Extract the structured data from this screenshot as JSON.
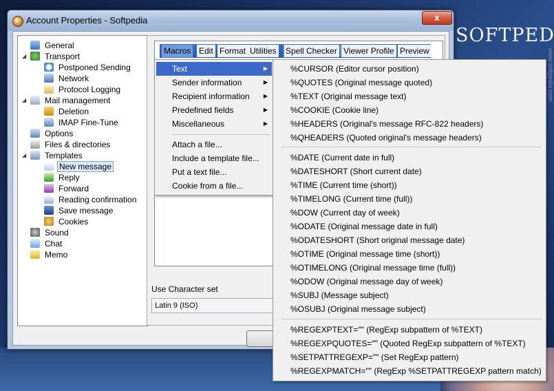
{
  "desktop": {
    "logo": "SOFTPEDIA",
    "side_text": "www.softpedia.com"
  },
  "window": {
    "title": "Account Properties - Softpedia",
    "close_glyph": "x"
  },
  "tree": [
    {
      "label": "General",
      "icon": "general-icon",
      "level": 1
    },
    {
      "label": "Transport",
      "icon": "transport-icon",
      "level": 1
    },
    {
      "label": "Postponed Sending",
      "icon": "clock-icon",
      "level": 2
    },
    {
      "label": "Network",
      "icon": "network-icon",
      "level": 2
    },
    {
      "label": "Protocol Logging",
      "icon": "log-icon",
      "level": 2
    },
    {
      "label": "Mail management",
      "icon": "mail-icon",
      "level": 1
    },
    {
      "label": "Deletion",
      "icon": "bin-icon",
      "level": 2
    },
    {
      "label": "IMAP Fine-Tune",
      "icon": "imap-icon",
      "level": 2
    },
    {
      "label": "Options",
      "icon": "options-icon",
      "level": 1
    },
    {
      "label": "Files & directories",
      "icon": "files-icon",
      "level": 1
    },
    {
      "label": "Templates",
      "icon": "templates-icon",
      "level": 1
    },
    {
      "label": "New message",
      "icon": "new-message-icon",
      "level": 2,
      "selected": true
    },
    {
      "label": "Reply",
      "icon": "reply-icon",
      "level": 2
    },
    {
      "label": "Forward",
      "icon": "forward-icon",
      "level": 2
    },
    {
      "label": "Reading confirmation",
      "icon": "read-icon",
      "level": 2
    },
    {
      "label": "Save message",
      "icon": "save-icon",
      "level": 2
    },
    {
      "label": "Cookies",
      "icon": "cookie-icon",
      "level": 2
    },
    {
      "label": "Sound",
      "icon": "sound-icon",
      "level": 1
    },
    {
      "label": "Chat",
      "icon": "chat-icon",
      "level": 1
    },
    {
      "label": "Memo",
      "icon": "memo-icon",
      "level": 1
    }
  ],
  "menubar": [
    "Macros",
    "Edit",
    "Format",
    "Utilities",
    "Spell Checker",
    "Viewer Profile",
    "Preview"
  ],
  "charset": {
    "label": "Use Character set",
    "value": "Latin 9 (ISO)"
  },
  "macros_menu": {
    "submenus": [
      "Text",
      "Sender information",
      "Recipient information",
      "Predefined fields",
      "Miscellaneous"
    ],
    "actions": [
      "Attach a file...",
      "Include a template file...",
      "Put a text file...",
      "Cookie from a file..."
    ]
  },
  "text_menu": {
    "group1": [
      "%CURSOR (Editor cursor position)",
      "%QUOTES (Original message quoted)",
      "%TEXT (Original message text)",
      "%COOKIE (Cookie line)",
      "%HEADERS (Original's message RFC-822 headers)",
      "%QHEADERS (Quoted original's message headers)"
    ],
    "group2": [
      "%DATE (Current date in full)",
      "%DATESHORT (Short current date)",
      "%TIME (Current time (short))",
      "%TIMELONG (Current time (full))",
      "%DOW (Current day of week)",
      "%ODATE (Original message date in full)",
      "%ODATESHORT (Short original message date)",
      "%OTIME (Original message time (short))",
      "%OTIMELONG (Original message time (full))",
      "%ODOW (Original message day of week)",
      "%SUBJ (Message subject)",
      "%OSUBJ (Original message subject)"
    ],
    "group3": [
      "%REGEXPTEXT=\"\" (RegExp subpattern of %TEXT)",
      "%REGEXPQUOTES=\"\" (Quoted RegExp subpattern of %TEXT)",
      "%SETPATTREGEXP=\"\" (Set RegExp pattern)",
      "%REGEXPMATCH=\"\" (RegExp %SETPATTREGEXP pattern match)"
    ]
  }
}
